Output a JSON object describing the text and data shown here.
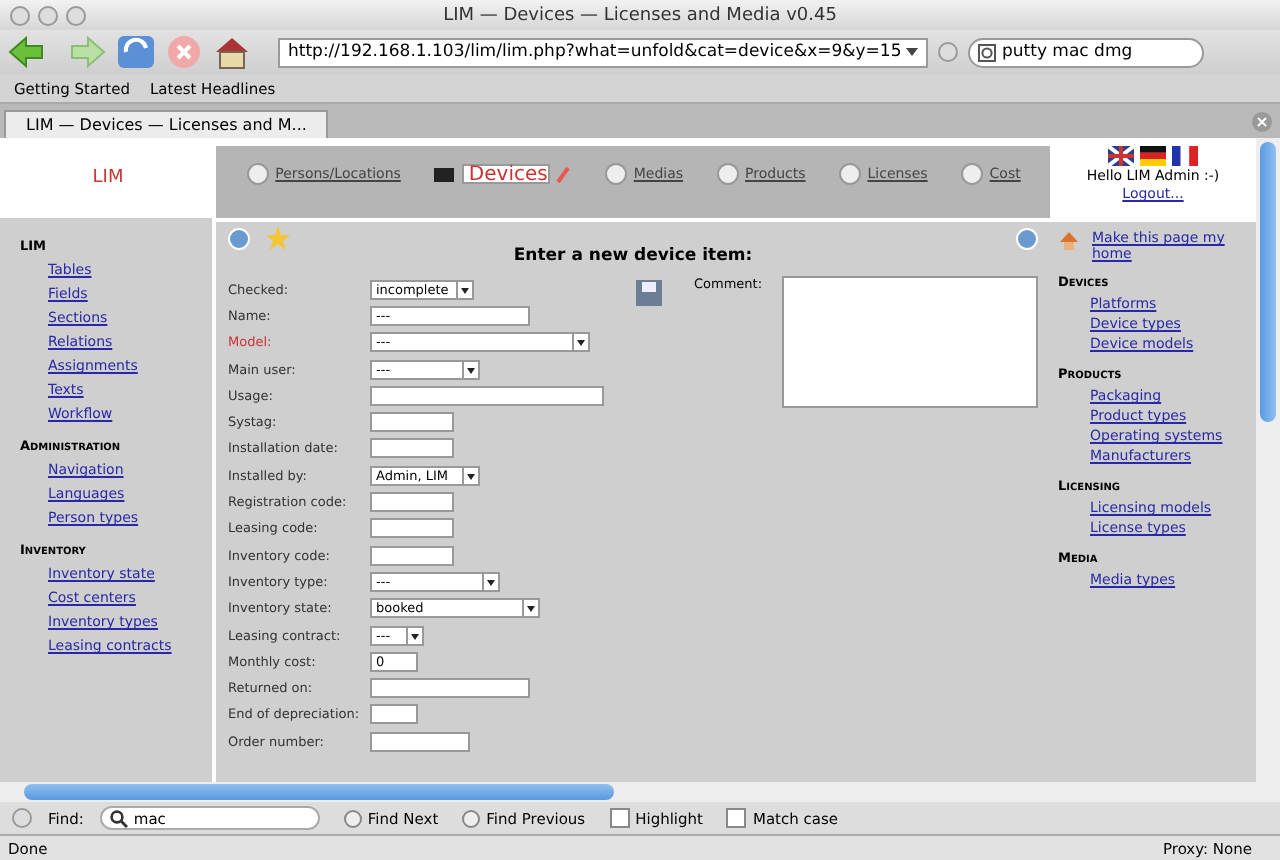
{
  "window": {
    "title": "LIM — Devices — Licenses and Media v0.45"
  },
  "toolbar": {
    "url": "http://192.168.1.103/lim/lim.php?what=unfold&cat=device&x=9&y=15",
    "search": "putty mac dmg"
  },
  "bookmarks": [
    "Getting Started",
    "Latest Headlines"
  ],
  "tabs": [
    {
      "title": "LIM — Devices — Licenses and M...",
      "selected": true
    }
  ],
  "page": {
    "logo": "LIM",
    "nav": [
      {
        "label": "Persons/Locations",
        "selected": false
      },
      {
        "label": "Devices",
        "selected": true
      },
      {
        "label": "Medias",
        "selected": false
      },
      {
        "label": "Products",
        "selected": false
      },
      {
        "label": "Licenses",
        "selected": false
      },
      {
        "label": "Cost",
        "selected": false
      }
    ],
    "user": {
      "greeting": "Hello LIM Admin :-)",
      "logout": "Logout..."
    },
    "left_menu": [
      {
        "heading": "LIM",
        "items": [
          "Tables",
          "Fields",
          "Sections",
          "Relations",
          "Assignments",
          "Texts",
          "Workflow"
        ]
      },
      {
        "heading": "Administration",
        "items": [
          "Navigation",
          "Languages",
          "Person types"
        ]
      },
      {
        "heading": "Inventory",
        "items": [
          "Inventory state",
          "Cost centers",
          "Inventory types",
          "Leasing contracts"
        ]
      }
    ],
    "form": {
      "title": "Enter a new device item:",
      "comment_label": "Comment:",
      "fields": [
        {
          "label": "Checked:",
          "kind": "select",
          "value": "incomplete",
          "required": false
        },
        {
          "label": "Name:",
          "kind": "text",
          "value": "---",
          "required": false
        },
        {
          "label": "Model:",
          "kind": "select",
          "value": "---",
          "required": true
        },
        {
          "label": "Main user:",
          "kind": "select",
          "value": "---",
          "required": false
        },
        {
          "label": "Usage:",
          "kind": "text",
          "required": false
        },
        {
          "label": "Systag:",
          "kind": "text",
          "required": false
        },
        {
          "label": "Installation date:",
          "kind": "text",
          "required": false
        },
        {
          "label": "Installed by:",
          "kind": "select",
          "value": "Admin, LIM",
          "required": false
        },
        {
          "label": "Registration code:",
          "kind": "text",
          "required": false
        },
        {
          "label": "Leasing code:",
          "kind": "text",
          "required": false
        },
        {
          "label": "Inventory code:",
          "kind": "text",
          "required": false
        },
        {
          "label": "Inventory type:",
          "kind": "select",
          "value": "---",
          "required": false
        },
        {
          "label": "Inventory state:",
          "kind": "select",
          "value": "booked",
          "required": false
        },
        {
          "label": "Leasing contract:",
          "kind": "select",
          "value": "---",
          "required": false
        },
        {
          "label": "Monthly cost:",
          "kind": "text",
          "value": "0",
          "required": false
        },
        {
          "label": "Returned on:",
          "kind": "text",
          "required": false
        },
        {
          "label": "End of depreciation:",
          "kind": "text",
          "required": false
        },
        {
          "label": "Order number:",
          "kind": "text",
          "required": false
        }
      ]
    },
    "right_menu": {
      "home_link": "Make this page my home",
      "sections": [
        {
          "heading": "Devices",
          "items": [
            "Platforms",
            "Device types",
            "Device models"
          ]
        },
        {
          "heading": "Products",
          "items": [
            "Packaging",
            "Product types",
            "Operating systems",
            "Manufacturers"
          ]
        },
        {
          "heading": "Licensing",
          "items": [
            "Licensing models",
            "License types"
          ]
        },
        {
          "heading": "Media",
          "items": [
            "Media types"
          ]
        }
      ]
    }
  },
  "find_bar": {
    "label": "Find:",
    "value": "mac",
    "buttons": [
      "Find Next",
      "Find Previous"
    ],
    "options": [
      {
        "label": "Highlight",
        "checked": false
      },
      {
        "label": "Match case",
        "checked": false
      }
    ]
  },
  "status_bar": {
    "left": "Done",
    "right": "Proxy: None"
  }
}
